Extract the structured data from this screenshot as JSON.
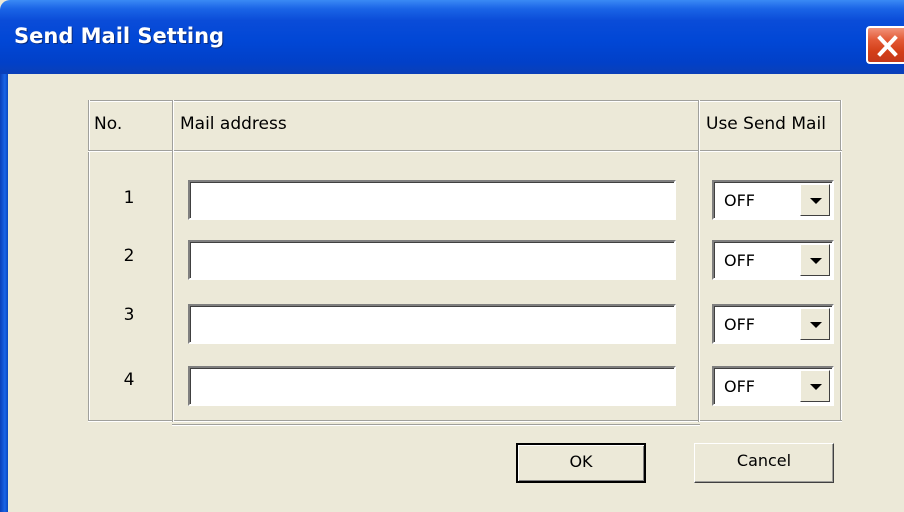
{
  "window": {
    "title": "Send Mail Setting"
  },
  "table": {
    "columns": [
      "No.",
      "Mail address",
      "Use Send Mail"
    ],
    "rows": [
      {
        "no": "1",
        "mail_address": "",
        "use_send_mail": "OFF"
      },
      {
        "no": "2",
        "mail_address": "",
        "use_send_mail": "OFF"
      },
      {
        "no": "3",
        "mail_address": "",
        "use_send_mail": "OFF"
      },
      {
        "no": "4",
        "mail_address": "",
        "use_send_mail": "OFF"
      }
    ]
  },
  "buttons": {
    "ok_label": "OK",
    "cancel_label": "Cancel"
  },
  "icons": {
    "close": "close-icon",
    "dropdown": "chevron-down-icon"
  },
  "colors": {
    "titlebar": "#0147d6",
    "dialog_bg": "#ece9d8",
    "close_button": "#d33e17"
  }
}
